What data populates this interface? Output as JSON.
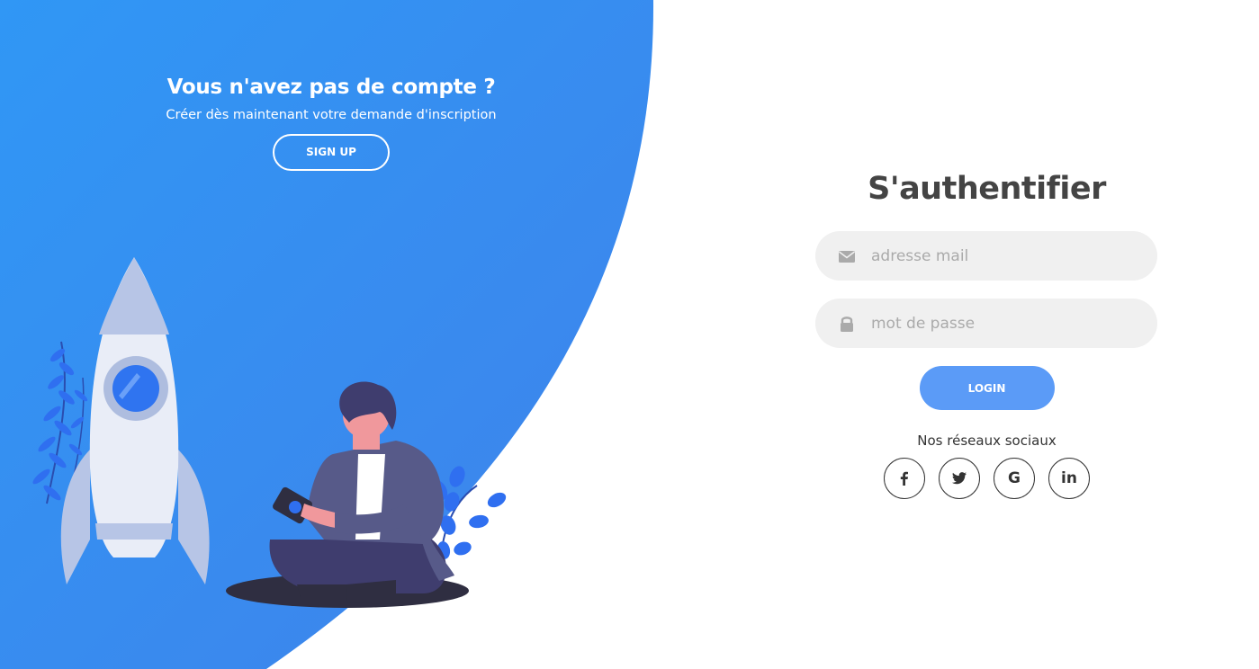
{
  "promo": {
    "title": "Vous n'avez pas de compte ?",
    "subtitle": "Créer dès maintenant votre demande d'inscription",
    "signup_label": "SIGN UP"
  },
  "auth": {
    "title": "S'authentifier",
    "email_placeholder": "adresse mail",
    "email_icon": "envelope-icon",
    "password_placeholder": "mot de passe",
    "password_icon": "lock-icon",
    "login_label": "LOGIN",
    "social_label": "Nos réseaux sociaux",
    "socials": [
      {
        "name": "facebook",
        "icon": "facebook-icon"
      },
      {
        "name": "twitter",
        "icon": "twitter-icon"
      },
      {
        "name": "google",
        "icon": "google-icon",
        "text": "G"
      },
      {
        "name": "linkedin",
        "icon": "linkedin-icon",
        "text": "in"
      }
    ]
  },
  "colors": {
    "primary": "#3a8ef0",
    "login_button": "#5b9bf7",
    "field_bg": "#f0f0f0",
    "title_text": "#444444"
  }
}
